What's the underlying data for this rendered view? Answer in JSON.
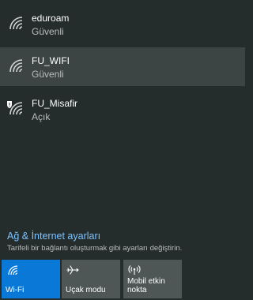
{
  "networks": [
    {
      "name": "eduroam",
      "status": "Güvenli",
      "icon": "wifi-icon",
      "selected": false
    },
    {
      "name": "FU_WIFI",
      "status": "Güvenli",
      "icon": "wifi-icon",
      "selected": true
    },
    {
      "name": "FU_Misafir",
      "status": "Açık",
      "icon": "wifi-open-shield-icon",
      "selected": false
    }
  ],
  "settings": {
    "link_label": "Ağ & İnternet ayarları",
    "description": "Tarifeli bir bağlantı oluşturmak gibi ayarları değiştirin."
  },
  "tiles": [
    {
      "label": "Wi-Fi",
      "icon": "wifi-icon",
      "active": true
    },
    {
      "label": "Uçak modu",
      "icon": "airplane-icon",
      "active": false
    },
    {
      "label": "Mobil etkin nokta",
      "icon": "hotspot-icon",
      "active": false
    }
  ],
  "colors": {
    "background": "#252c2c",
    "selected_row": "#3d4444",
    "accent_tile": "#0a78d6",
    "tile": "#4f5656",
    "link": "#7ec3ff"
  }
}
